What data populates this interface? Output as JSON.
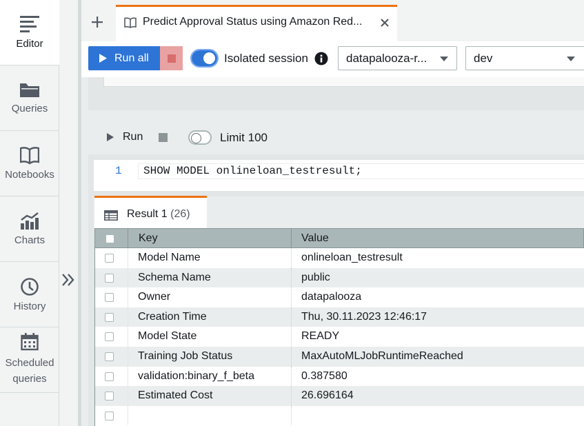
{
  "nav": {
    "items": [
      {
        "label": "Editor",
        "icon": "editor-icon"
      },
      {
        "label": "Queries",
        "icon": "folder-icon"
      },
      {
        "label": "Notebooks",
        "icon": "book-icon"
      },
      {
        "label": "Charts",
        "icon": "chart-icon"
      },
      {
        "label": "History",
        "icon": "clock-icon"
      },
      {
        "label": "Scheduled queries",
        "icon": "calendar-icon"
      }
    ],
    "scheduled_line1": "Scheduled",
    "scheduled_line2": "queries"
  },
  "tabs": {
    "active_title": "Predict Approval Status using Amazon Red..."
  },
  "toolbar": {
    "run_all": "Run all",
    "isolated_session": "Isolated session",
    "connection": "datapalooza-r...",
    "database": "dev"
  },
  "cell": {
    "run": "Run",
    "limit": "Limit 100",
    "line_number": "1",
    "code": "SHOW MODEL onlineloan_testresult;"
  },
  "results": {
    "tab_label": "Result 1",
    "count": "(26)",
    "columns": [
      "Key",
      "Value"
    ],
    "rows": [
      {
        "key": "Model Name",
        "value": "onlineloan_testresult"
      },
      {
        "key": "Schema Name",
        "value": "public"
      },
      {
        "key": "Owner",
        "value": "datapalooza"
      },
      {
        "key": "Creation Time",
        "value": "Thu, 30.11.2023 12:46:17"
      },
      {
        "key": "Model State",
        "value": "READY"
      },
      {
        "key": "Training Job Status",
        "value": "MaxAutoMLJobRuntimeReached"
      },
      {
        "key": "validation:binary_f_beta",
        "value": "0.387580"
      },
      {
        "key": "Estimated Cost",
        "value": "26.696164"
      },
      {
        "key": "",
        "value": ""
      }
    ]
  },
  "colors": {
    "accent": "#2d74d6",
    "tab_highlight": "#ec7211",
    "stop": "#e8a2a2"
  }
}
